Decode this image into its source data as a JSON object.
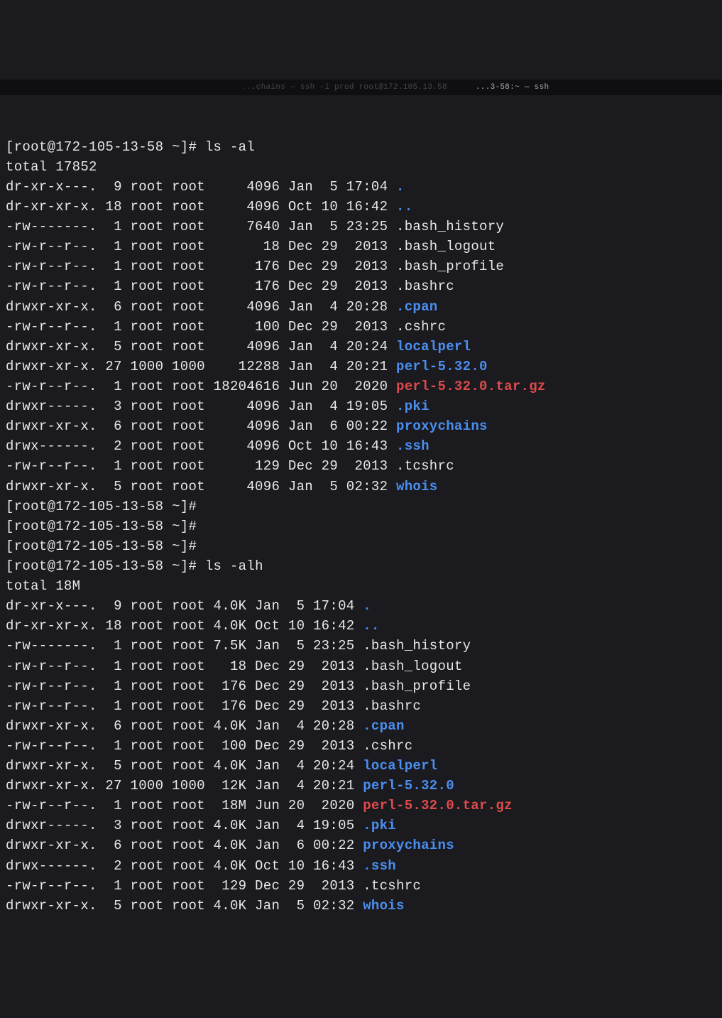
{
  "tabs": {
    "left": "...chains — ssh -i prod root@172.105.13.58",
    "right": "...3-58:~ — ssh"
  },
  "prompt": "[root@172-105-13-58 ~]#",
  "commands": {
    "ls_al": "ls -al",
    "ls_alh": "ls -alh"
  },
  "totals": {
    "al": "total 17852",
    "alh": "total 18M"
  },
  "listing_al": [
    {
      "perms": "dr-xr-x---.",
      "links": " 9",
      "owner": "root",
      "group": "root",
      "size": "    4096",
      "date": "Jan  5 17:04",
      "name": ".",
      "cls": "dir"
    },
    {
      "perms": "dr-xr-xr-x.",
      "links": "18",
      "owner": "root",
      "group": "root",
      "size": "    4096",
      "date": "Oct 10 16:42",
      "name": "..",
      "cls": "dir"
    },
    {
      "perms": "-rw-------.",
      "links": " 1",
      "owner": "root",
      "group": "root",
      "size": "    7640",
      "date": "Jan  5 23:25",
      "name": ".bash_history",
      "cls": "plain"
    },
    {
      "perms": "-rw-r--r--.",
      "links": " 1",
      "owner": "root",
      "group": "root",
      "size": "      18",
      "date": "Dec 29  2013",
      "name": ".bash_logout",
      "cls": "plain"
    },
    {
      "perms": "-rw-r--r--.",
      "links": " 1",
      "owner": "root",
      "group": "root",
      "size": "     176",
      "date": "Dec 29  2013",
      "name": ".bash_profile",
      "cls": "plain"
    },
    {
      "perms": "-rw-r--r--.",
      "links": " 1",
      "owner": "root",
      "group": "root",
      "size": "     176",
      "date": "Dec 29  2013",
      "name": ".bashrc",
      "cls": "plain"
    },
    {
      "perms": "drwxr-xr-x.",
      "links": " 6",
      "owner": "root",
      "group": "root",
      "size": "    4096",
      "date": "Jan  4 20:28",
      "name": ".cpan",
      "cls": "dir"
    },
    {
      "perms": "-rw-r--r--.",
      "links": " 1",
      "owner": "root",
      "group": "root",
      "size": "     100",
      "date": "Dec 29  2013",
      "name": ".cshrc",
      "cls": "plain"
    },
    {
      "perms": "drwxr-xr-x.",
      "links": " 5",
      "owner": "root",
      "group": "root",
      "size": "    4096",
      "date": "Jan  4 20:24",
      "name": "localperl",
      "cls": "dir"
    },
    {
      "perms": "drwxr-xr-x.",
      "links": "27",
      "owner": "1000",
      "group": "1000",
      "size": "   12288",
      "date": "Jan  4 20:21",
      "name": "perl-5.32.0",
      "cls": "dir"
    },
    {
      "perms": "-rw-r--r--.",
      "links": " 1",
      "owner": "root",
      "group": "root",
      "size": "18204616",
      "date": "Jun 20  2020",
      "name": "perl-5.32.0.tar.gz",
      "cls": "archive"
    },
    {
      "perms": "drwxr-----.",
      "links": " 3",
      "owner": "root",
      "group": "root",
      "size": "    4096",
      "date": "Jan  4 19:05",
      "name": ".pki",
      "cls": "dir"
    },
    {
      "perms": "drwxr-xr-x.",
      "links": " 6",
      "owner": "root",
      "group": "root",
      "size": "    4096",
      "date": "Jan  6 00:22",
      "name": "proxychains",
      "cls": "dir"
    },
    {
      "perms": "drwx------.",
      "links": " 2",
      "owner": "root",
      "group": "root",
      "size": "    4096",
      "date": "Oct 10 16:43",
      "name": ".ssh",
      "cls": "dir"
    },
    {
      "perms": "-rw-r--r--.",
      "links": " 1",
      "owner": "root",
      "group": "root",
      "size": "     129",
      "date": "Dec 29  2013",
      "name": ".tcshrc",
      "cls": "plain"
    },
    {
      "perms": "drwxr-xr-x.",
      "links": " 5",
      "owner": "root",
      "group": "root",
      "size": "    4096",
      "date": "Jan  5 02:32",
      "name": "whois",
      "cls": "dir"
    }
  ],
  "listing_alh": [
    {
      "perms": "dr-xr-x---.",
      "links": " 9",
      "owner": "root",
      "group": "root",
      "size": "4.0K",
      "date": "Jan  5 17:04",
      "name": ".",
      "cls": "dir"
    },
    {
      "perms": "dr-xr-xr-x.",
      "links": "18",
      "owner": "root",
      "group": "root",
      "size": "4.0K",
      "date": "Oct 10 16:42",
      "name": "..",
      "cls": "dir"
    },
    {
      "perms": "-rw-------.",
      "links": " 1",
      "owner": "root",
      "group": "root",
      "size": "7.5K",
      "date": "Jan  5 23:25",
      "name": ".bash_history",
      "cls": "plain"
    },
    {
      "perms": "-rw-r--r--.",
      "links": " 1",
      "owner": "root",
      "group": "root",
      "size": "  18",
      "date": "Dec 29  2013",
      "name": ".bash_logout",
      "cls": "plain"
    },
    {
      "perms": "-rw-r--r--.",
      "links": " 1",
      "owner": "root",
      "group": "root",
      "size": " 176",
      "date": "Dec 29  2013",
      "name": ".bash_profile",
      "cls": "plain"
    },
    {
      "perms": "-rw-r--r--.",
      "links": " 1",
      "owner": "root",
      "group": "root",
      "size": " 176",
      "date": "Dec 29  2013",
      "name": ".bashrc",
      "cls": "plain"
    },
    {
      "perms": "drwxr-xr-x.",
      "links": " 6",
      "owner": "root",
      "group": "root",
      "size": "4.0K",
      "date": "Jan  4 20:28",
      "name": ".cpan",
      "cls": "dir"
    },
    {
      "perms": "-rw-r--r--.",
      "links": " 1",
      "owner": "root",
      "group": "root",
      "size": " 100",
      "date": "Dec 29  2013",
      "name": ".cshrc",
      "cls": "plain"
    },
    {
      "perms": "drwxr-xr-x.",
      "links": " 5",
      "owner": "root",
      "group": "root",
      "size": "4.0K",
      "date": "Jan  4 20:24",
      "name": "localperl",
      "cls": "dir"
    },
    {
      "perms": "drwxr-xr-x.",
      "links": "27",
      "owner": "1000",
      "group": "1000",
      "size": " 12K",
      "date": "Jan  4 20:21",
      "name": "perl-5.32.0",
      "cls": "dir"
    },
    {
      "perms": "-rw-r--r--.",
      "links": " 1",
      "owner": "root",
      "group": "root",
      "size": " 18M",
      "date": "Jun 20  2020",
      "name": "perl-5.32.0.tar.gz",
      "cls": "archive"
    },
    {
      "perms": "drwxr-----.",
      "links": " 3",
      "owner": "root",
      "group": "root",
      "size": "4.0K",
      "date": "Jan  4 19:05",
      "name": ".pki",
      "cls": "dir"
    },
    {
      "perms": "drwxr-xr-x.",
      "links": " 6",
      "owner": "root",
      "group": "root",
      "size": "4.0K",
      "date": "Jan  6 00:22",
      "name": "proxychains",
      "cls": "dir"
    },
    {
      "perms": "drwx------.",
      "links": " 2",
      "owner": "root",
      "group": "root",
      "size": "4.0K",
      "date": "Oct 10 16:43",
      "name": ".ssh",
      "cls": "dir"
    },
    {
      "perms": "-rw-r--r--.",
      "links": " 1",
      "owner": "root",
      "group": "root",
      "size": " 129",
      "date": "Dec 29  2013",
      "name": ".tcshrc",
      "cls": "plain"
    },
    {
      "perms": "drwxr-xr-x.",
      "links": " 5",
      "owner": "root",
      "group": "root",
      "size": "4.0K",
      "date": "Jan  5 02:32",
      "name": "whois",
      "cls": "dir"
    }
  ]
}
